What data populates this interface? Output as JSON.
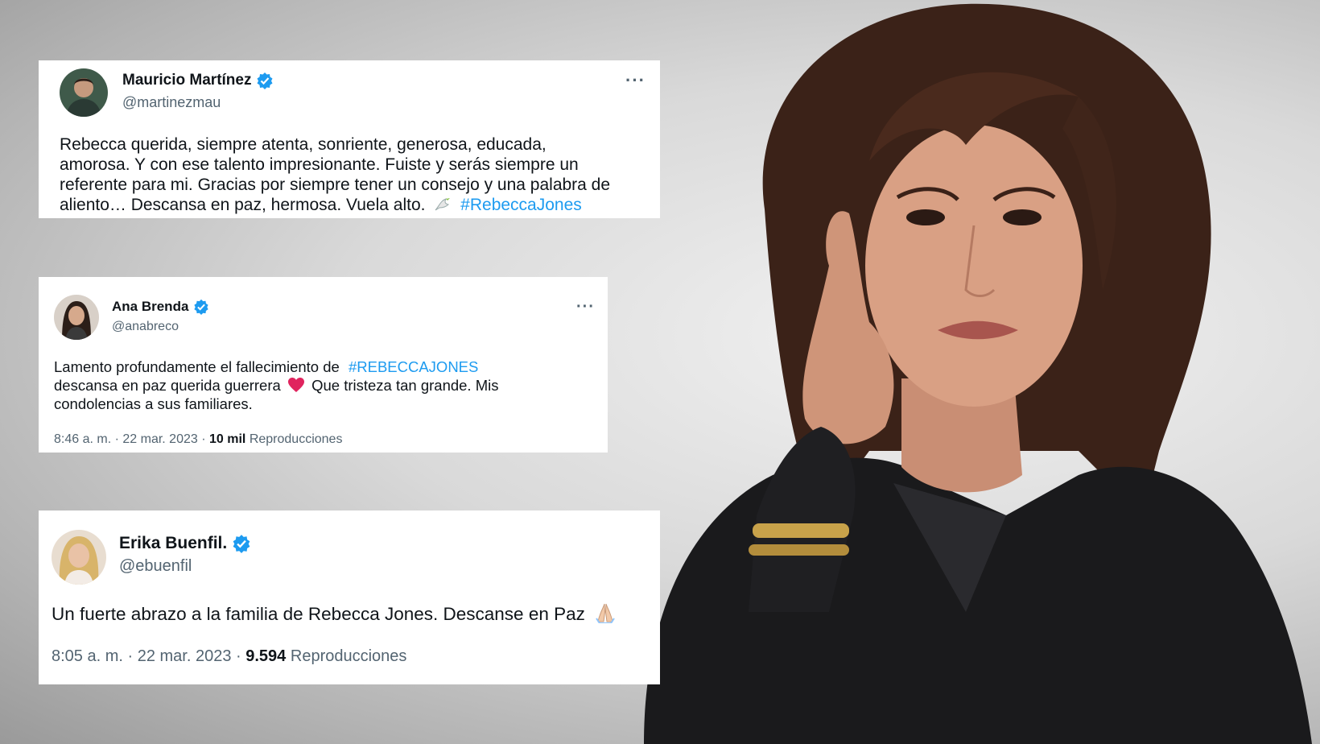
{
  "colors": {
    "accent": "#1d9bf0",
    "text": "#0f1419",
    "muted": "#536471",
    "heart": "#e0245e"
  },
  "tweets": [
    {
      "name": "Mauricio Martínez",
      "handle": "@martinezmau",
      "more": "···",
      "lines": [
        "Rebecca querida, siempre atenta, sonriente, generosa, educada,",
        "amorosa. Y con ese talento impresionante. Fuiste y serás siempre un",
        "referente para mi. Gracias por siempre tener un consejo y una palabra de",
        "aliento… Descansa en paz, hermosa. Vuela alto."
      ],
      "emoji": "dove-emoji",
      "hashtag": "#RebeccaJones"
    },
    {
      "name": "Ana Brenda",
      "handle": "@anabreco",
      "more": "···",
      "line1": "Lamento profundamente el fallecimiento de",
      "hashtag": "#REBECCAJONES",
      "line2a": "descansa en paz querida guerrera",
      "line2b": "Que tristeza tan grande. Mis",
      "line3": "condolencias a sus familiares.",
      "emoji": "heart-emoji",
      "time": "8:46 a. m. · 22 mar. 2023 ·",
      "views_count": "10 mil",
      "views_label": "Reproducciones"
    },
    {
      "name": "Erika Buenfil.",
      "handle": "@ebuenfil",
      "text": "Un fuerte abrazo a la familia de Rebecca Jones. Descanse en Paz",
      "emoji": "praying-hands-emoji",
      "time": "8:05 a. m. · 22 mar. 2023 ·",
      "views_count": "9.594",
      "views_label": "Reproducciones"
    }
  ]
}
